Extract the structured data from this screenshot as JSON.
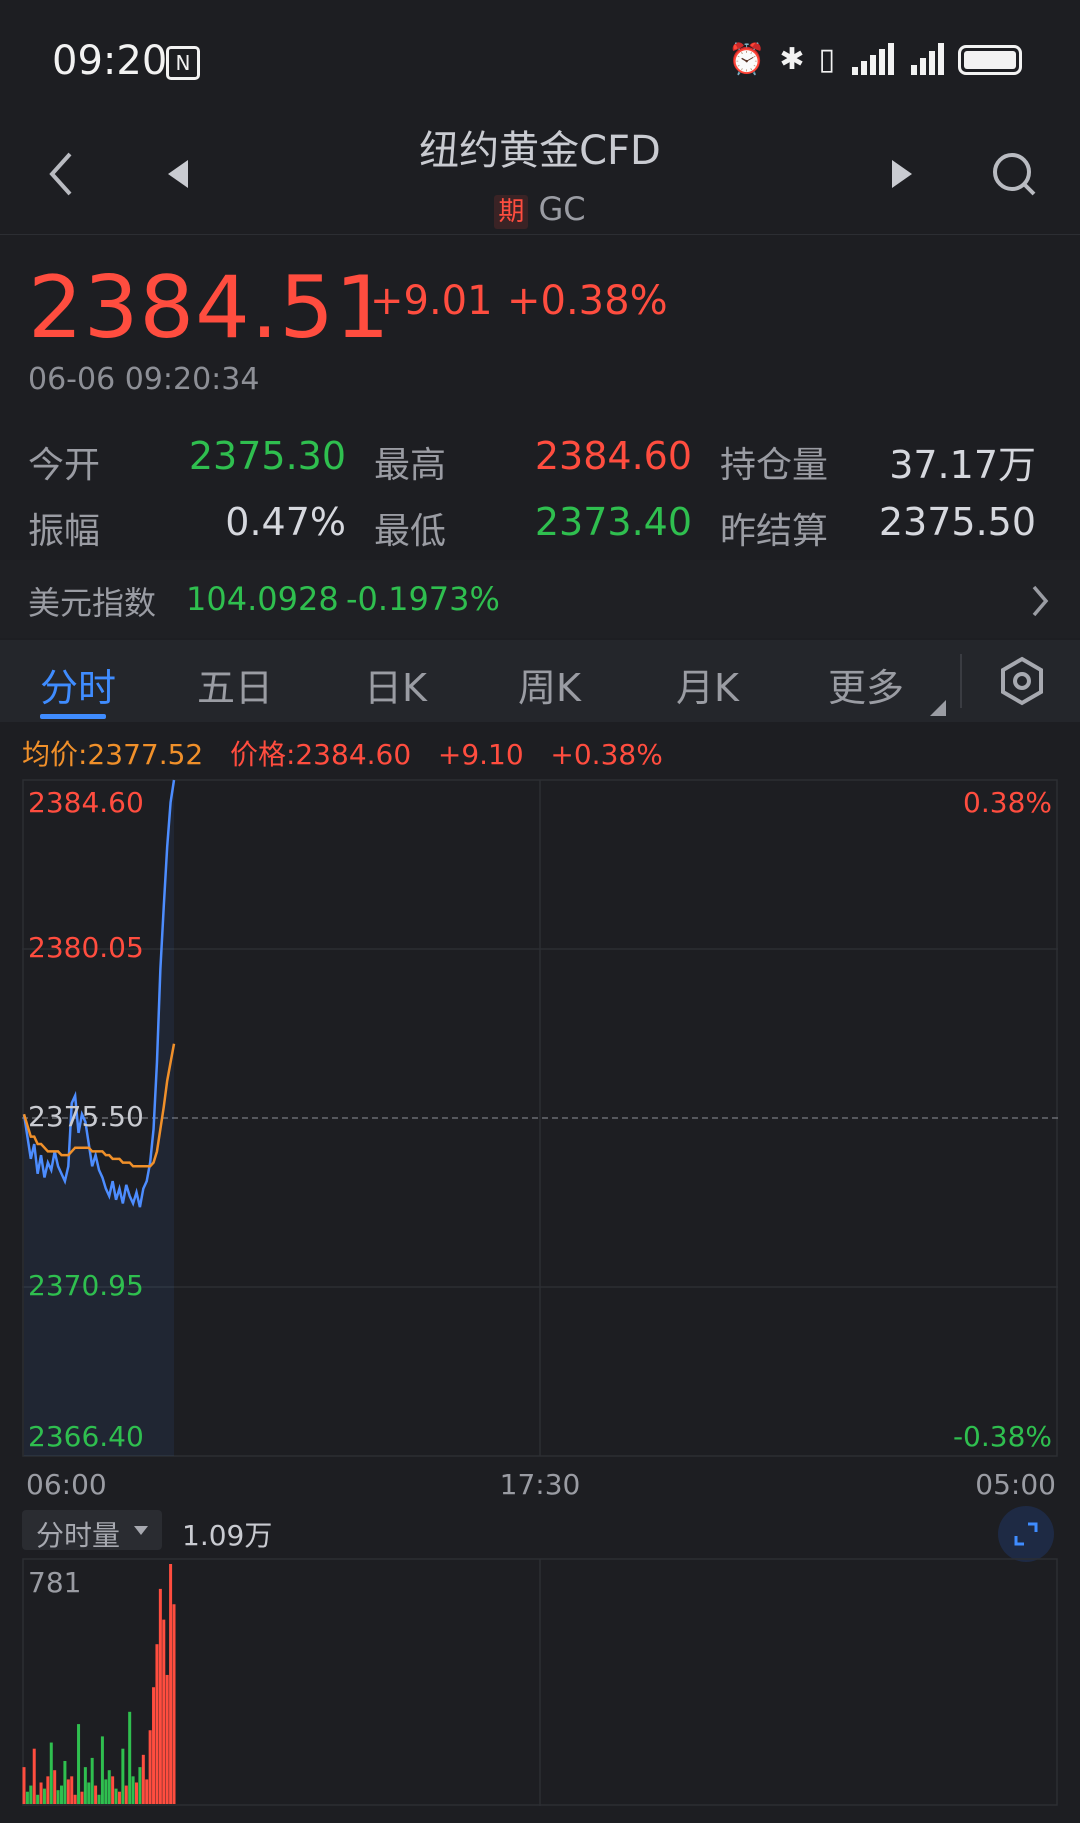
{
  "status_bar": {
    "time": "09:20"
  },
  "header": {
    "title": "纽约黄金CFD",
    "tag": "期",
    "code": "GC"
  },
  "quote": {
    "price": "2384.51",
    "change": "+9.01",
    "change_pct": "+0.38%",
    "timestamp": "06-06 09:20:34"
  },
  "stats": [
    {
      "label": "今开",
      "value": "2375.30",
      "color": "#2fbf4f"
    },
    {
      "label": "最高",
      "value": "2384.60",
      "color": "#ff4d3f"
    },
    {
      "label": "持仓量",
      "value": "37.17万",
      "color": "#d6d8de"
    },
    {
      "label": "振幅",
      "value": "0.47%",
      "color": "#d6d8de"
    },
    {
      "label": "最低",
      "value": "2373.40",
      "color": "#2fbf4f"
    },
    {
      "label": "昨结算",
      "value": "2375.50",
      "color": "#d6d8de"
    }
  ],
  "usd_index": {
    "label": "美元指数",
    "value": "104.0928",
    "change": "-0.1973%"
  },
  "tabs": [
    {
      "label": "分时"
    },
    {
      "label": "五日"
    },
    {
      "label": "日K"
    },
    {
      "label": "周K"
    },
    {
      "label": "月K"
    },
    {
      "label": "更多"
    }
  ],
  "legend": {
    "avg": "均价:2377.52",
    "price": "价格:2384.60",
    "change": "+9.10",
    "change_pct": "+0.38%"
  },
  "volume_panel": {
    "selector": "分时量",
    "total": "1.09万",
    "max_label": "781"
  },
  "colors": {
    "up": "#ff4d3f",
    "down": "#2fbf4f",
    "line": "#4d8dff",
    "avg": "#f0902a",
    "accent": "#3f8cff"
  },
  "chart_data": {
    "type": "line",
    "y_labels": [
      "2384.60",
      "2380.05",
      "2375.50",
      "2370.95",
      "2366.40"
    ],
    "pct_labels": [
      "0.38%",
      "-0.38%"
    ],
    "x_labels": [
      "06:00",
      "17:30",
      "05:00"
    ],
    "ylim": [
      2366.4,
      2384.6
    ],
    "reference": 2375.5,
    "total_points": 1380,
    "series": [
      {
        "name": "价格",
        "values": [
          2375.6,
          2375.0,
          2374.4,
          2374.8,
          2374.0,
          2374.5,
          2373.9,
          2374.3,
          2374.1,
          2374.6,
          2374.2,
          2374.0,
          2373.8,
          2374.2,
          2375.9,
          2376.1,
          2375.1,
          2375.6,
          2375.4,
          2374.8,
          2374.2,
          2374.5,
          2374.1,
          2373.9,
          2373.6,
          2373.4,
          2373.8,
          2373.3,
          2373.6,
          2373.2,
          2373.7,
          2373.4,
          2373.2,
          2373.5,
          2373.1,
          2373.6,
          2373.8,
          2374.3,
          2375.2,
          2377.0,
          2379.5,
          2381.2,
          2382.8,
          2384.0,
          2384.6
        ]
      },
      {
        "name": "均价",
        "values": [
          2375.6,
          2375.3,
          2375.0,
          2375.0,
          2374.8,
          2374.8,
          2374.7,
          2374.6,
          2374.6,
          2374.6,
          2374.6,
          2374.5,
          2374.5,
          2374.5,
          2374.6,
          2374.7,
          2374.7,
          2374.7,
          2374.7,
          2374.7,
          2374.6,
          2374.6,
          2374.6,
          2374.6,
          2374.5,
          2374.5,
          2374.4,
          2374.4,
          2374.4,
          2374.3,
          2374.3,
          2374.3,
          2374.2,
          2374.2,
          2374.2,
          2374.2,
          2374.2,
          2374.2,
          2374.3,
          2374.6,
          2375.2,
          2375.8,
          2376.5,
          2377.0,
          2377.5
        ]
      }
    ],
    "volume": [
      120,
      40,
      60,
      180,
      30,
      70,
      50,
      90,
      200,
      110,
      45,
      60,
      140,
      80,
      90,
      30,
      260,
      40,
      120,
      70,
      150,
      60,
      30,
      220,
      80,
      110,
      90,
      50,
      40,
      180,
      60,
      300,
      90,
      70,
      120,
      160,
      80,
      240,
      380,
      520,
      700,
      600,
      420,
      781,
      650
    ]
  }
}
